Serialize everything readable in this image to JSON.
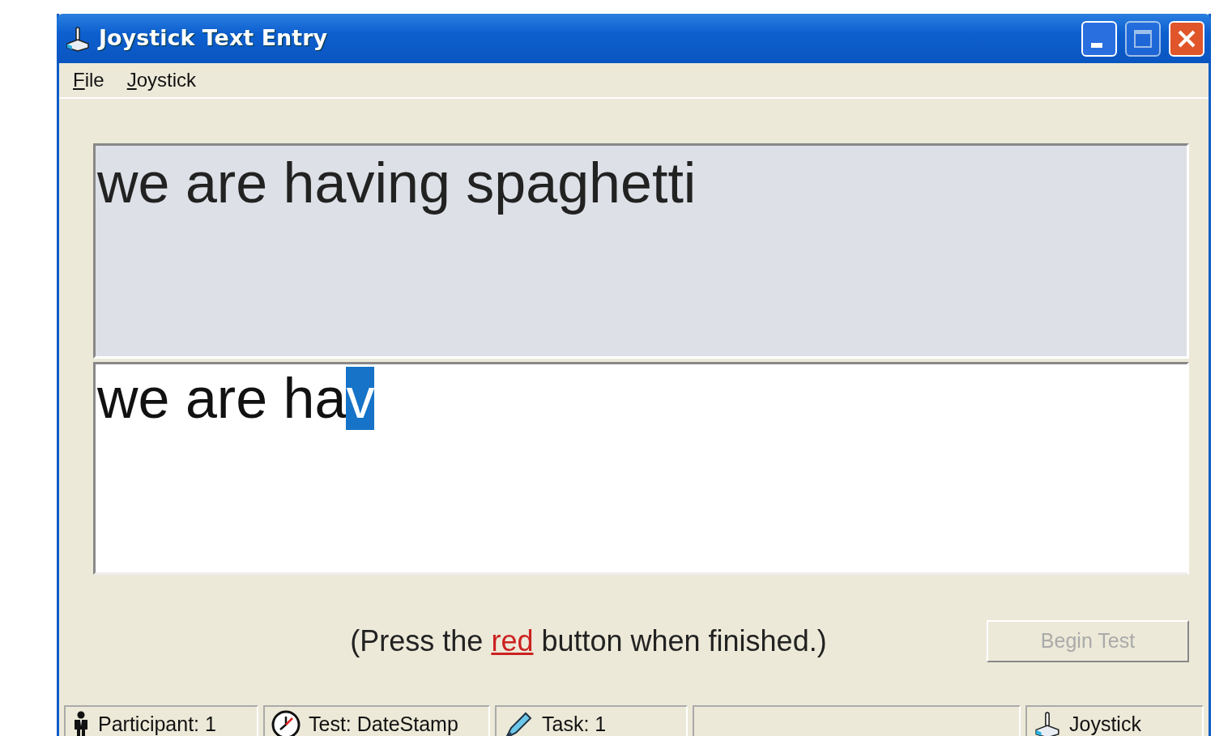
{
  "window": {
    "title": "Joystick Text Entry"
  },
  "menu": [
    {
      "label": "File"
    },
    {
      "label": "Joystick"
    }
  ],
  "target_phrase": "we are having spaghetti",
  "entry": {
    "text": "we are ha",
    "selected_text": "v"
  },
  "hint": {
    "before": "(Press the ",
    "highlight": "red",
    "color": "#cc2222",
    "after": " button when finished.)"
  },
  "begin_button": {
    "label": "Begin Test",
    "disabled": true
  },
  "status_bar": [
    {
      "kind": "participant",
      "text": "Participant: 1"
    },
    {
      "kind": "test",
      "text": "Test: DateStamp"
    },
    {
      "kind": "task",
      "text": "Task: 1"
    },
    {
      "kind": "blank"
    },
    {
      "kind": "device",
      "text": "Joystick"
    }
  ]
}
